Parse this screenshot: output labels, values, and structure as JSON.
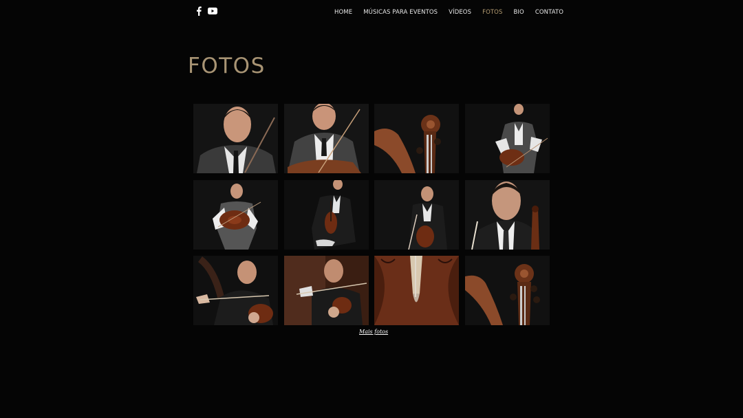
{
  "header": {
    "social": [
      {
        "name": "facebook-icon"
      },
      {
        "name": "youtube-icon"
      }
    ],
    "nav": [
      {
        "label": "HOME",
        "active": false
      },
      {
        "label": "MÚSICAS PARA EVENTOS",
        "active": false
      },
      {
        "label": "VÍDEOS",
        "active": false
      },
      {
        "label": "FOTOS",
        "active": true
      },
      {
        "label": "BIO",
        "active": false
      },
      {
        "label": "CONTATO",
        "active": false
      }
    ]
  },
  "main": {
    "title": "FOTOS",
    "more_link": "Mais fotos"
  },
  "gallery": {
    "photos": [
      {
        "subject": "portrait-violin-closeup"
      },
      {
        "subject": "portrait-violin-bow"
      },
      {
        "subject": "cello-scroll"
      },
      {
        "subject": "seated-violin"
      },
      {
        "subject": "standing-violin"
      },
      {
        "subject": "suit-violin-low"
      },
      {
        "subject": "suit-violin-bow"
      },
      {
        "subject": "portrait-cello-bow"
      },
      {
        "subject": "playing-violin-lean"
      },
      {
        "subject": "playing-violin-warm"
      },
      {
        "subject": "cello-body-detail"
      },
      {
        "subject": "cello-scroll-pegs"
      }
    ]
  },
  "colors": {
    "background": "#050505",
    "accent": "#b59d72",
    "title": "#a89474",
    "nav_text": "#e8e8e8"
  }
}
